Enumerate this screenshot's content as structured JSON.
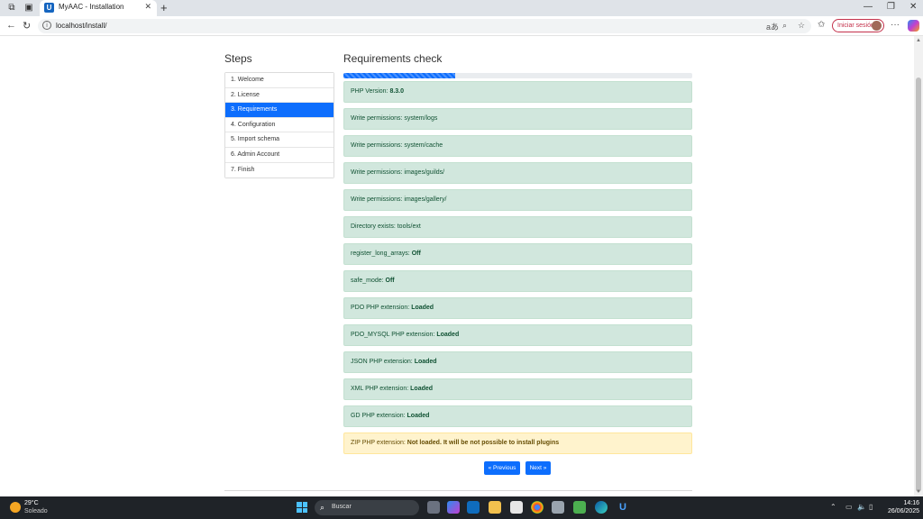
{
  "browser": {
    "tab_title": "MyAAC - Installation",
    "favicon_letter": "U",
    "url": "localhost/install/",
    "signin_label": "Iniciar sesión"
  },
  "sidebar": {
    "title": "Steps",
    "items": [
      {
        "label": "1. Welcome"
      },
      {
        "label": "2. License"
      },
      {
        "label": "3. Requirements"
      },
      {
        "label": "4. Configuration"
      },
      {
        "label": "5. Import schema"
      },
      {
        "label": "6. Admin Account"
      },
      {
        "label": "7. Finish"
      }
    ],
    "active_index": 2
  },
  "main": {
    "title": "Requirements check",
    "progress_percent": 32,
    "checks": [
      {
        "label": "PHP Version: ",
        "value": "8.3.0",
        "status": "success"
      },
      {
        "label": "Write permissions: system/logs",
        "value": "",
        "status": "success"
      },
      {
        "label": "Write permissions: system/cache",
        "value": "",
        "status": "success"
      },
      {
        "label": "Write permissions: images/guilds/",
        "value": "",
        "status": "success"
      },
      {
        "label": "Write permissions: images/gallery/",
        "value": "",
        "status": "success"
      },
      {
        "label": "Directory exists: tools/ext",
        "value": "",
        "status": "success"
      },
      {
        "label": "register_long_arrays: ",
        "value": "Off",
        "status": "success"
      },
      {
        "label": "safe_mode: ",
        "value": "Off",
        "status": "success"
      },
      {
        "label": "PDO PHP extension: ",
        "value": "Loaded",
        "status": "success"
      },
      {
        "label": "PDO_MYSQL PHP extension: ",
        "value": "Loaded",
        "status": "success"
      },
      {
        "label": "JSON PHP extension: ",
        "value": "Loaded",
        "status": "success"
      },
      {
        "label": "XML PHP extension: ",
        "value": "Loaded",
        "status": "success"
      },
      {
        "label": "GD PHP extension: ",
        "value": "Loaded",
        "status": "success"
      },
      {
        "label": "ZIP PHP extension: ",
        "value": "Not loaded. It will be not possible to install plugins",
        "status": "warning"
      }
    ],
    "prev_label": "« Previous",
    "next_label": "Next »"
  },
  "taskbar": {
    "temperature": "29°C",
    "weather": "Soleado",
    "search_placeholder": "Buscar",
    "time": "14:16",
    "date": "26/06/2025"
  },
  "colors": {
    "primary": "#0d6efd",
    "success_bg": "#d1e7dd",
    "warning_bg": "#fff3cd"
  }
}
